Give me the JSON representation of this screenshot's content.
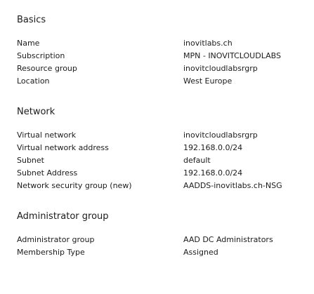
{
  "sections": [
    {
      "title": "Basics",
      "rows": [
        {
          "label": "Name",
          "value": "inovitlabs.ch"
        },
        {
          "label": "Subscription",
          "value": "MPN - INOVITCLOUDLABS"
        },
        {
          "label": "Resource group",
          "value": "inovitcloudlabsrgrp"
        },
        {
          "label": "Location",
          "value": "West Europe"
        }
      ]
    },
    {
      "title": "Network",
      "rows": [
        {
          "label": "Virtual network",
          "value": "inovitcloudlabsrgrp"
        },
        {
          "label": "Virtual network address",
          "value": "192.168.0.0/24"
        },
        {
          "label": "Subnet",
          "value": "default"
        },
        {
          "label": "Subnet Address",
          "value": "192.168.0.0/24"
        },
        {
          "label": "Network security group (new)",
          "value": "AADDS-inovitlabs.ch-NSG"
        }
      ]
    },
    {
      "title": "Administrator group",
      "rows": [
        {
          "label": "Administrator group",
          "value": "AAD DC Administrators"
        },
        {
          "label": "Membership Type",
          "value": "Assigned"
        }
      ]
    }
  ]
}
